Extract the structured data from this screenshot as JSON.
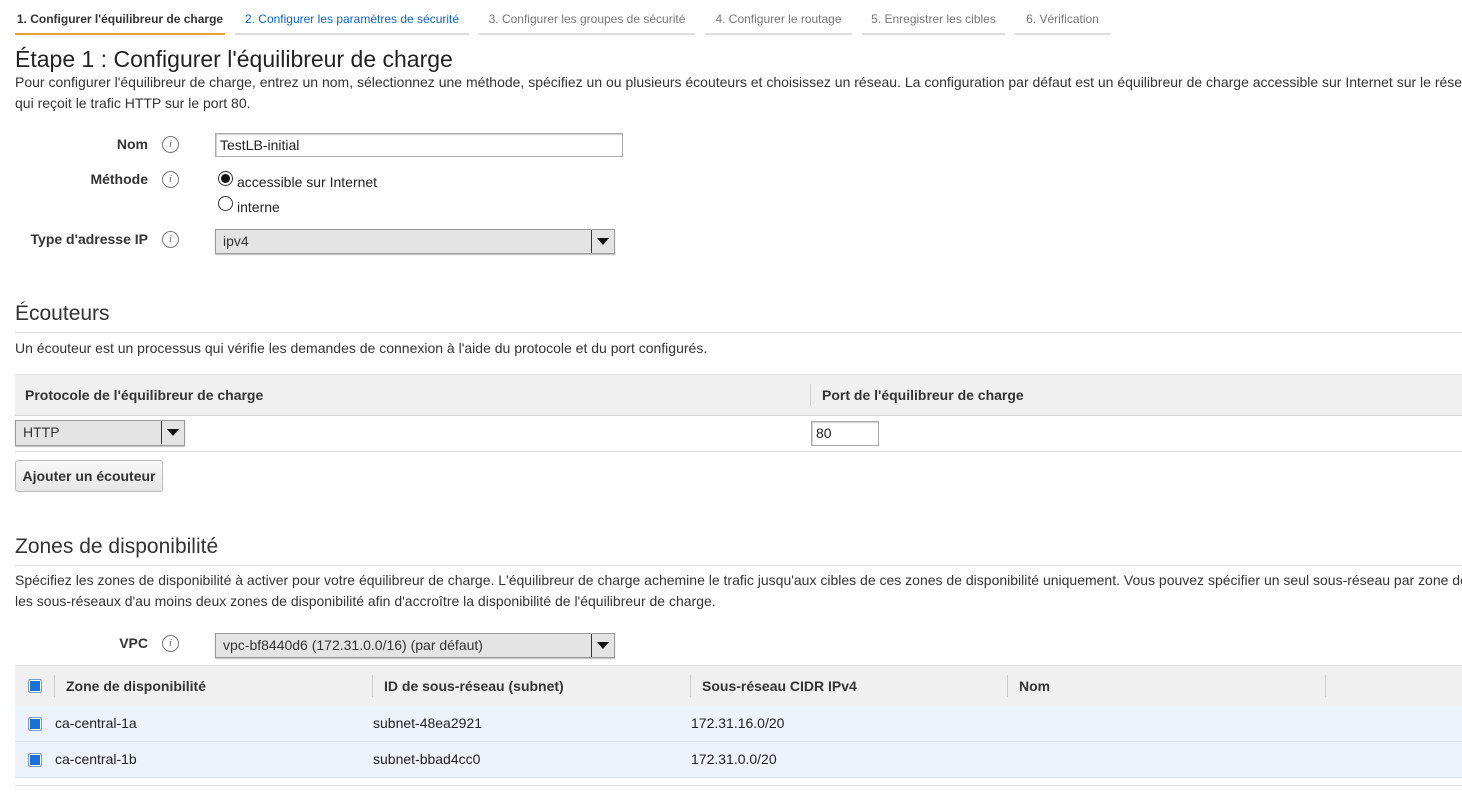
{
  "tabs": [
    {
      "label": "1. Configurer l'équilibreur de charge"
    },
    {
      "label": "2. Configurer les paramètres de sécurité"
    },
    {
      "label": "3. Configurer les groupes de sécurité"
    },
    {
      "label": "4. Configurer le routage"
    },
    {
      "label": "5. Enregistrer les cibles"
    },
    {
      "label": "6. Vérification"
    }
  ],
  "step": {
    "title": "Étape 1 : Configurer l'équilibreur de charge",
    "desc_line1": "Pour configurer l'équilibreur de charge, entrez un nom, sélectionnez une méthode, spécifiez un ou plusieurs écouteurs et choisissez un réseau. La configuration par défaut est un équilibreur de charge accessible sur Internet sur le réseau s",
    "desc_line2": "qui reçoit le trafic HTTP sur le port 80."
  },
  "form": {
    "name_label": "Nom",
    "name_value": "TestLB-initial",
    "method_label": "Méthode",
    "method_options": [
      "accessible sur Internet",
      "interne"
    ],
    "ip_type_label": "Type d'adresse IP",
    "ip_type_value": "ipv4",
    "info_glyph": "i"
  },
  "listeners": {
    "title": "Écouteurs",
    "desc": "Un écouteur est un processus qui vérifie les demandes de connexion à l'aide du protocole et du port configurés.",
    "col_protocol": "Protocole de l'équilibreur de charge",
    "col_port": "Port de l'équilibreur de charge",
    "protocol_value": "HTTP",
    "port_value": "80",
    "add_button": "Ajouter un écouteur"
  },
  "zones": {
    "title": "Zones de disponibilité",
    "desc_line1": "Spécifiez les zones de disponibilité à activer pour votre équilibreur de charge. L'équilibreur de charge achemine le trafic jusqu'aux cibles de ces zones de disponibilité uniquement. Vous pouvez spécifier un seul sous-réseau par zone de disp",
    "desc_line2": "les sous-réseaux d'au moins deux zones de disponibilité afin d'accroître la disponibilité de l'équilibreur de charge.",
    "vpc_label": "VPC",
    "vpc_value": "vpc-bf8440d6 (172.31.0.0/16) (par défaut)",
    "columns": [
      "Zone de disponibilité",
      "ID de sous-réseau (subnet)",
      "Sous-réseau CIDR IPv4",
      "Nom"
    ],
    "rows": [
      {
        "zone": "ca-central-1a",
        "subnet": "subnet-48ea2921",
        "cidr": "172.31.16.0/20",
        "name": ""
      },
      {
        "zone": "ca-central-1b",
        "subnet": "subnet-bbad4cc0",
        "cidr": "172.31.0.0/20",
        "name": ""
      }
    ]
  },
  "icons": {
    "info": "info-icon",
    "dropdown": "chevron-down-icon"
  },
  "colors": {
    "accent_tab": "#e7a03c",
    "link": "#1166bb",
    "checkbox": "#1b72d6",
    "row_bg": "#eef3fb"
  }
}
